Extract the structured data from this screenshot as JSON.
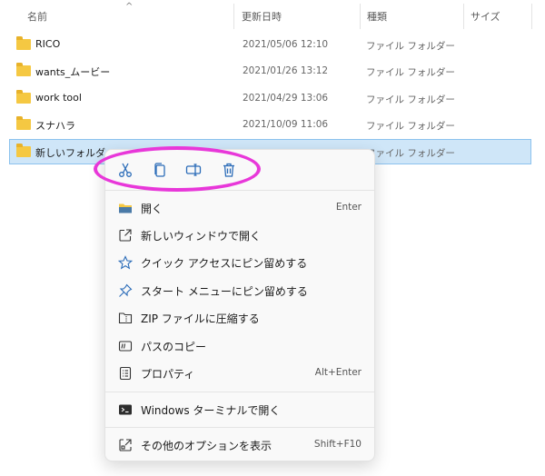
{
  "columns": {
    "name": "名前",
    "date": "更新日時",
    "type": "種類",
    "size": "サイズ",
    "sort_icon": "chevron-up-icon"
  },
  "rows": [
    {
      "name": "RICO",
      "date": "2021/05/06 12:10",
      "type": "ファイル フォルダー"
    },
    {
      "name": "wants_ムービー",
      "date": "2021/01/26 13:12",
      "type": "ファイル フォルダー"
    },
    {
      "name": "work tool",
      "date": "2021/04/29 13:06",
      "type": "ファイル フォルダー"
    },
    {
      "name": "スナハラ",
      "date": "2021/10/09 11:06",
      "type": "ファイル フォルダー"
    },
    {
      "name": "新しいフォルダー",
      "date": "",
      "type": "ファイル フォルダー"
    }
  ],
  "quick_actions": [
    {
      "icon": "cut-icon"
    },
    {
      "icon": "copy-icon"
    },
    {
      "icon": "rename-icon"
    },
    {
      "icon": "delete-icon"
    }
  ],
  "menu": {
    "items": [
      {
        "icon": "folder-open-icon",
        "label": "開く",
        "shortcut": "Enter"
      },
      {
        "icon": "new-window-icon",
        "label": "新しいウィンドウで開く",
        "shortcut": ""
      },
      {
        "icon": "star-icon",
        "label": "クイック アクセスにピン留めする",
        "shortcut": ""
      },
      {
        "icon": "pin-icon",
        "label": "スタート メニューにピン留めする",
        "shortcut": ""
      },
      {
        "icon": "zip-icon",
        "label": "ZIP ファイルに圧縮する",
        "shortcut": ""
      },
      {
        "icon": "copy-path-icon",
        "label": "パスのコピー",
        "shortcut": ""
      },
      {
        "icon": "properties-icon",
        "label": "プロパティ",
        "shortcut": "Alt+Enter"
      },
      {
        "icon": "terminal-icon",
        "label": "Windows ターミナルで開く",
        "shortcut": ""
      },
      {
        "icon": "more-options-icon",
        "label": "その他のオプションを表示",
        "shortcut": "Shift+F10"
      }
    ]
  },
  "colors": {
    "selection": "#cfe6f8",
    "highlight_ring": "#e837d9",
    "icon_blue": "#2b6cb8",
    "folder": "#f5c842"
  }
}
